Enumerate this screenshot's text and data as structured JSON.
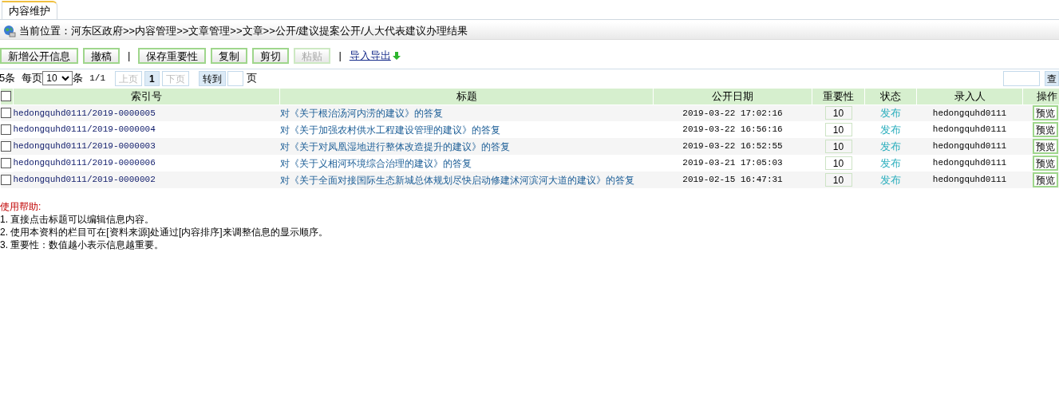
{
  "tabs": [
    {
      "label": "内容维护",
      "selected": true
    }
  ],
  "breadcrumb": {
    "label": "当前位置：",
    "path": "河东区政府>>内容管理>>文章管理>>文章>>公开/建议提案公开/人大代表建议办理结果"
  },
  "toolbar": [
    {
      "kind": "button",
      "label": "新增公开信息",
      "disabled": false
    },
    {
      "kind": "button",
      "label": "撤稿",
      "disabled": false
    },
    {
      "kind": "separator",
      "label": "|"
    },
    {
      "kind": "button",
      "label": "保存重要性",
      "disabled": false
    },
    {
      "kind": "button",
      "label": "复制",
      "disabled": false
    },
    {
      "kind": "button",
      "label": "剪切",
      "disabled": false
    },
    {
      "kind": "button",
      "label": "粘贴",
      "disabled": true
    },
    {
      "kind": "separator",
      "label": "|"
    },
    {
      "kind": "link",
      "label": "导入导出",
      "disabled": false
    }
  ],
  "pager": {
    "total": "5条",
    "per_page_label": "每页",
    "per_page": "10",
    "unit": "条",
    "pages": "1/1",
    "prev": {
      "label": "上页",
      "disabled": true
    },
    "pages_list": [
      {
        "label": "1",
        "selected": true
      }
    ],
    "next": {
      "label": "下页",
      "disabled": true
    },
    "goto": "转到",
    "goto_unit": "页",
    "search_button": "查"
  },
  "table": {
    "select_all": {
      "checked": false
    },
    "columns": [
      "索引号",
      "标题",
      "公开日期",
      "重要性",
      "状态",
      "录入人",
      "操作"
    ],
    "rows": [
      {
        "checked": false,
        "index": "hedongquhd0111/2019-0000005",
        "title": "对《关于根治汤河内涝的建议》的答复",
        "date": "2019-03-22 17:02:16",
        "importance": "10",
        "status": "发布",
        "author": "hedongquhd0111",
        "action": "预览"
      },
      {
        "checked": false,
        "index": "hedongquhd0111/2019-0000004",
        "title": "对《关于加强农村供水工程建设管理的建议》的答复",
        "date": "2019-03-22 16:56:16",
        "importance": "10",
        "status": "发布",
        "author": "hedongquhd0111",
        "action": "预览"
      },
      {
        "checked": false,
        "index": "hedongquhd0111/2019-0000003",
        "title": "对《关于对凤凰湿地进行整体改造提升的建议》的答复",
        "date": "2019-03-22 16:52:55",
        "importance": "10",
        "status": "发布",
        "author": "hedongquhd0111",
        "action": "预览"
      },
      {
        "checked": false,
        "index": "hedongquhd0111/2019-0000006",
        "title": "对《关于义相河环境综合治理的建议》的答复",
        "date": "2019-03-21 17:05:03",
        "importance": "10",
        "status": "发布",
        "author": "hedongquhd0111",
        "action": "预览"
      },
      {
        "checked": false,
        "index": "hedongquhd0111/2019-0000002",
        "title": "对《关于全面对接国际生态新城总体规划尽快启动修建沭河滨河大道的建议》的答复",
        "date": "2019-02-15 16:47:31",
        "importance": "10",
        "status": "发布",
        "author": "hedongquhd0111",
        "action": "预览"
      }
    ]
  },
  "help": {
    "title": "使用帮助:",
    "lines": [
      "1. 直接点击标题可以编辑信息内容。",
      "2. 使用本资料的栏目可在[资料来源]处通过[内容排序]来调整信息的显示顺序。",
      "3. 重要性：数值越小表示信息越重要。"
    ]
  }
}
